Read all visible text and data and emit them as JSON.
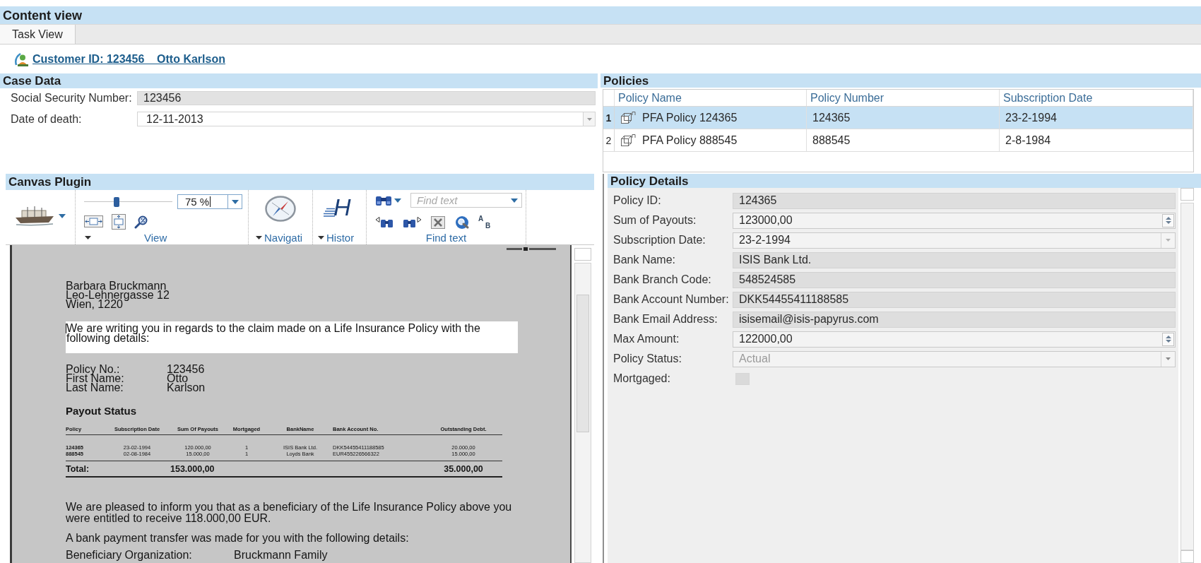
{
  "content_view": {
    "title": "Content view"
  },
  "tabs": [
    {
      "label": "Task View",
      "selected": true
    }
  ],
  "customer": {
    "link": "Customer ID: 123456    Otto Karlson"
  },
  "case_data": {
    "title": "Case Data",
    "fields": [
      {
        "label": "Social Security Number:",
        "value": "123456",
        "kind": "text"
      },
      {
        "label": "Date of death:",
        "value": "12-11-2013",
        "kind": "dropdown"
      }
    ]
  },
  "policies": {
    "title": "Policies",
    "columns": [
      "Policy Name",
      "Policy Number",
      "Subscription Date"
    ],
    "rows": [
      {
        "index": "1",
        "name": "PFA Policy 124365",
        "number": "124365",
        "date": "23-2-1994",
        "selected": true
      },
      {
        "index": "2",
        "name": "PFA Policy 888545",
        "number": "888545",
        "date": "2-8-1984",
        "selected": false
      }
    ]
  },
  "canvas_plugin": {
    "title": "Canvas Plugin",
    "toolbar": {
      "slider": {
        "level": 0.37
      },
      "zoom": {
        "value": "75 %"
      },
      "view_label": "View",
      "navigation_label": "Navigati",
      "history_glyph": "H",
      "history_label": "Histor",
      "find": {
        "placeholder": "Find text"
      },
      "case_glyphs": [
        "A",
        "B"
      ],
      "find_label": "Find text"
    },
    "document": {
      "recipient": [
        "Barbara Bruckmann",
        "Leo-Lehnergasse 12",
        "Wien, 1220"
      ],
      "intro": "We are writing you in regards to the claim made on a Life Insurance Policy with the following details:",
      "details": [
        {
          "label": "Policy No.:",
          "value": "123456"
        },
        {
          "label": "First Name:",
          "value": "Otto"
        },
        {
          "label": "Last Name:",
          "value": "Karlson"
        }
      ],
      "payout_title": "Payout Status",
      "payout_table": {
        "columns": [
          "Policy",
          "Subscription Date",
          "Sum Of Payouts",
          "Mortgaged",
          "BankName",
          "Bank Account No.",
          "Outstanding Debt."
        ],
        "rows": [
          [
            "124365",
            "23-02-1994",
            "120.000,00",
            "1",
            "ISIS Bank Ltd.",
            "DKK54455411188585",
            "20.000,00"
          ],
          [
            "888545",
            "02-08-1984",
            "15.000,00",
            "1",
            "Loyds Bank",
            "EUR455226566322",
            "15.000,00"
          ]
        ],
        "total": {
          "label": "Total:",
          "sum": "153.000,00",
          "debt": "35.000,00"
        }
      },
      "paragraphs": [
        "We are pleased to inform you that as a beneficiary of the Life Insurance Policy above you were entitled to receive 118.000,00 EUR.",
        "A bank payment transfer was made for you with the following details:"
      ],
      "beneficiary": {
        "label": "Beneficiary Organization:",
        "value": "Bruckmann Family"
      }
    }
  },
  "policy_details": {
    "title": "Policy Details",
    "fields": [
      {
        "label": "Policy ID:",
        "value": "124365",
        "kind": "text",
        "disabled": false
      },
      {
        "label": "Sum of Payouts:",
        "value": "123000,00",
        "kind": "spinner",
        "disabled": false
      },
      {
        "label": "Subscription Date:",
        "value": "23-2-1994",
        "kind": "dropdown",
        "disabled": false
      },
      {
        "label": "Bank Name:",
        "value": "ISIS Bank Ltd.",
        "kind": "text",
        "disabled": false
      },
      {
        "label": "Bank Branch Code:",
        "value": "548524585",
        "kind": "text",
        "disabled": false
      },
      {
        "label": "Bank Account Number:",
        "value": "DKK54455411188585",
        "kind": "text",
        "disabled": false
      },
      {
        "label": "Bank Email Address:",
        "value": "isisemail@isis-papyrus.com",
        "kind": "text",
        "disabled": false
      },
      {
        "label": "Max Amount:",
        "value": "122000,00",
        "kind": "spinner",
        "disabled": false
      },
      {
        "label": "Policy Status:",
        "value": "Actual",
        "kind": "dropdown",
        "disabled": true
      },
      {
        "label": "Mortgaged:",
        "kind": "checkbox",
        "checked": false,
        "disabled": true
      }
    ]
  }
}
